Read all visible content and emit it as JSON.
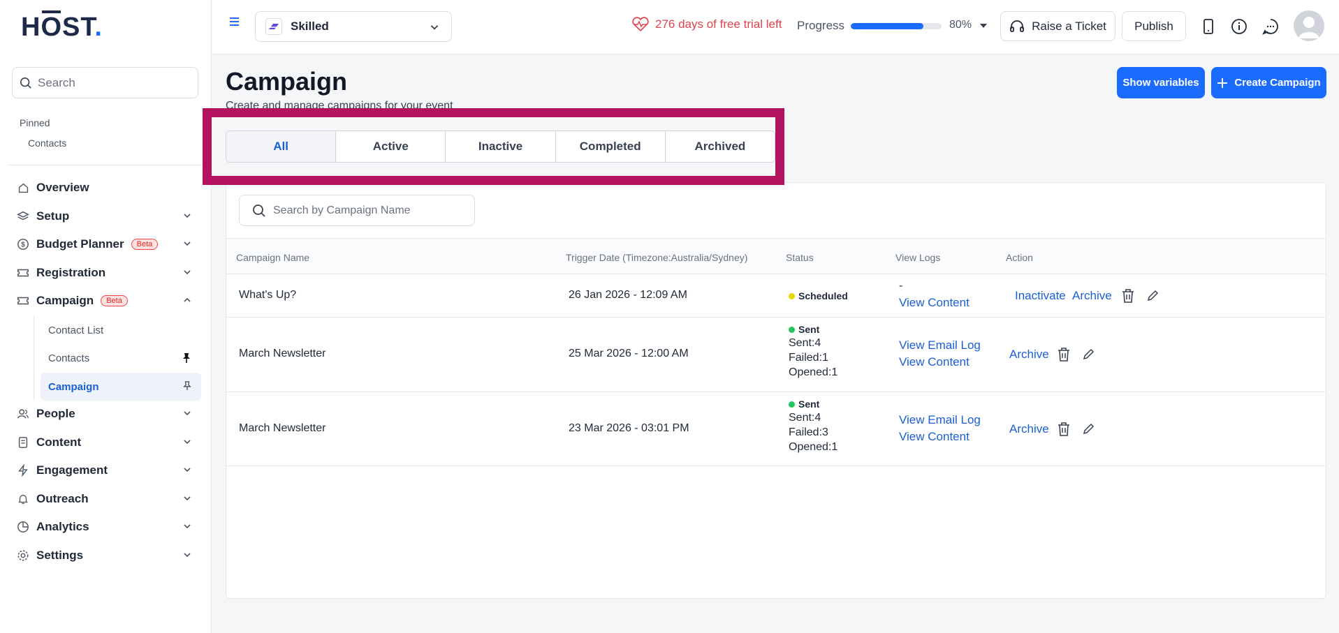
{
  "logo": {
    "text_h": "H",
    "text_o": "O",
    "text_st": "ST",
    "text_dot": "."
  },
  "sidebar": {
    "search_placeholder": "Search",
    "pinned_label": "Pinned",
    "pinned_items": [
      "Contacts"
    ],
    "nav": [
      {
        "label": "Overview"
      },
      {
        "label": "Setup"
      },
      {
        "label": "Budget Planner",
        "badge": "Beta"
      },
      {
        "label": "Registration"
      },
      {
        "label": "Campaign",
        "badge": "Beta"
      },
      {
        "label": "People"
      },
      {
        "label": "Content"
      },
      {
        "label": "Engagement"
      },
      {
        "label": "Outreach"
      },
      {
        "label": "Analytics"
      },
      {
        "label": "Settings"
      }
    ],
    "campaign_sub": [
      {
        "label": "Contact List"
      },
      {
        "label": "Contacts"
      },
      {
        "label": "Campaign"
      }
    ]
  },
  "topbar": {
    "event_name": "Skilled",
    "trial_text": "276 days of free trial left",
    "progress_label": "Progress",
    "progress_pct": "80%",
    "progress_value": 0.8,
    "raise_ticket": "Raise a Ticket",
    "publish": "Publish"
  },
  "page": {
    "title": "Campaign",
    "subtitle": "Create and manage campaigns for your event",
    "show_variables": "Show variables",
    "create_campaign": "Create Campaign"
  },
  "tabs": [
    "All",
    "Active",
    "Inactive",
    "Completed",
    "Archived"
  ],
  "table": {
    "search_placeholder": "Search by Campaign Name",
    "headers": {
      "name": "Campaign Name",
      "trigger": "Trigger Date (Timezone:Australia/Sydney)",
      "status": "Status",
      "logs": "View Logs",
      "action": "Action"
    },
    "rows": [
      {
        "name": "What's Up?",
        "date": "26 Jan 2026 - 12:09 AM",
        "status": "Scheduled",
        "status_color": "#e6d800",
        "stats": [],
        "log_dash": "-",
        "log_links": [
          "View Content"
        ],
        "actions": [
          "Inactivate",
          "Archive"
        ]
      },
      {
        "name": "March Newsletter",
        "date": "25 Mar 2026 - 12:00 AM",
        "status": "Sent",
        "status_color": "#22c55e",
        "stats": [
          "Sent:4",
          "Failed:1",
          "Opened:1"
        ],
        "log_dash": "",
        "log_links": [
          "View Email Log",
          "View Content"
        ],
        "actions": [
          "Archive"
        ]
      },
      {
        "name": "March Newsletter",
        "date": "23 Mar 2026 - 03:01 PM",
        "status": "Sent",
        "status_color": "#22c55e",
        "stats": [
          "Sent:4",
          "Failed:3",
          "Opened:1"
        ],
        "log_dash": "",
        "log_links": [
          "View Email Log",
          "View Content"
        ],
        "actions": [
          "Archive"
        ]
      }
    ]
  },
  "colors": {
    "accent": "#1a6bff",
    "highlight": "#b3125e",
    "trial": "#e0434b"
  }
}
